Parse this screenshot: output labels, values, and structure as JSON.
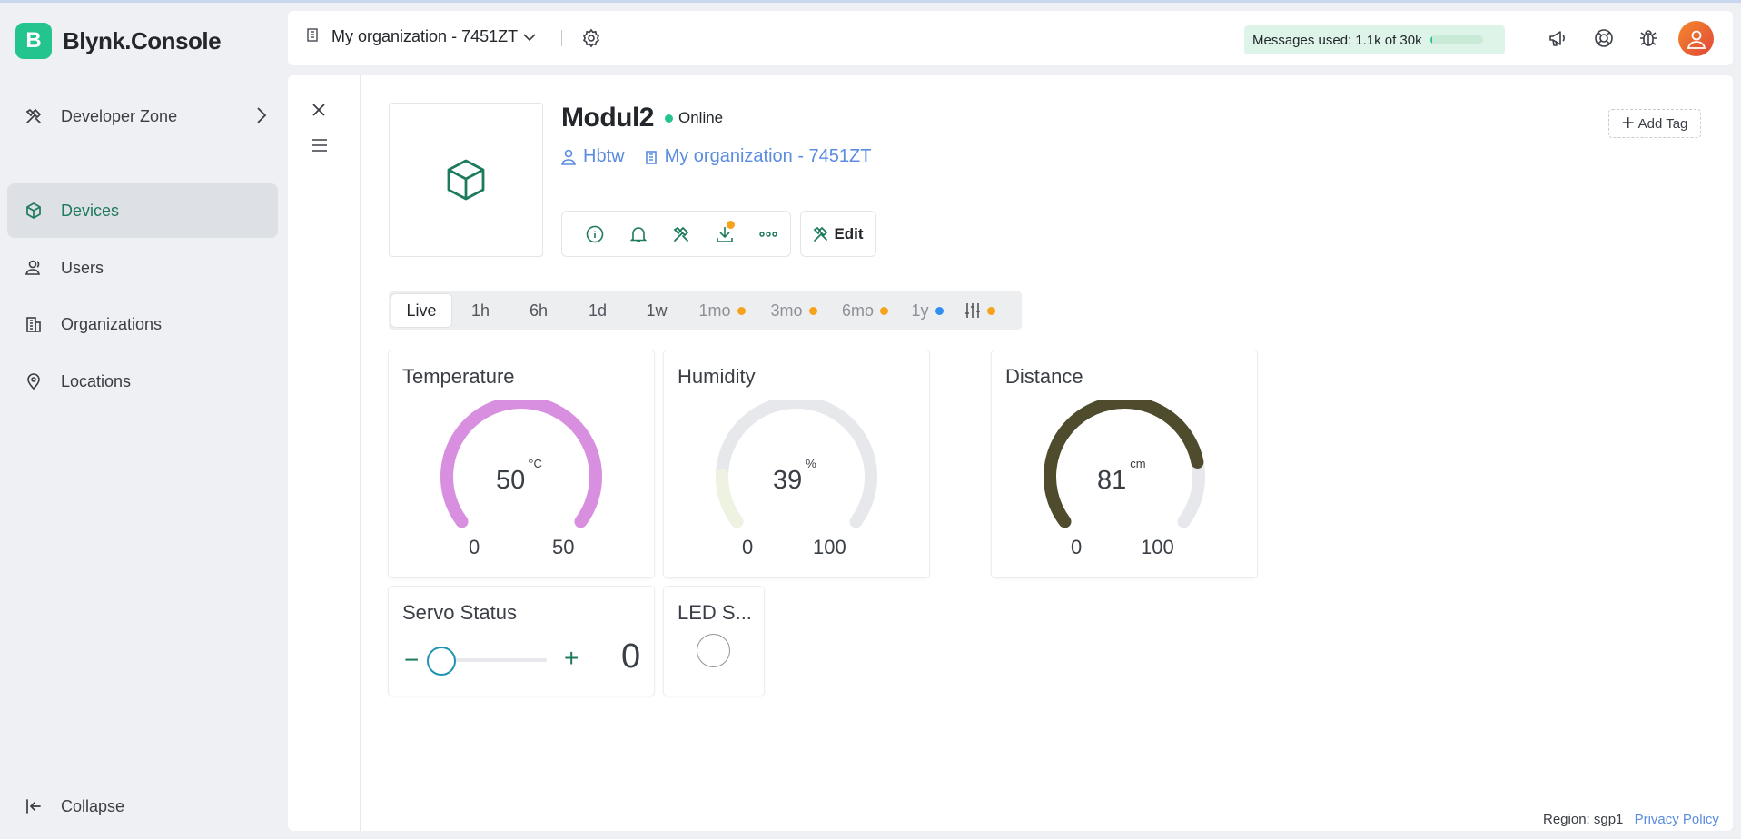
{
  "app": {
    "logo_letter": "B",
    "name": "Blynk.Console"
  },
  "sidebar": {
    "developer_zone": "Developer Zone",
    "items": [
      {
        "label": "Devices",
        "icon": "cube-icon",
        "active": true
      },
      {
        "label": "Users",
        "icon": "users-icon",
        "active": false
      },
      {
        "label": "Organizations",
        "icon": "buildings-icon",
        "active": false
      },
      {
        "label": "Locations",
        "icon": "location-pin-icon",
        "active": false
      }
    ],
    "collapse": "Collapse"
  },
  "header": {
    "organization": "My organization - 7451ZT",
    "messages_label": "Messages used:",
    "messages_value": "1.1k of 30k",
    "messages_fraction": 0.037,
    "icons": [
      "megaphone-icon",
      "lifebuoy-icon",
      "bug-icon",
      "avatar"
    ]
  },
  "device": {
    "name": "Modul2",
    "status": "Online",
    "owner": "Hbtw",
    "organization": "My organization - 7451ZT",
    "actions": [
      "info-icon",
      "bell-icon",
      "tools-icon",
      "download-icon",
      "more-icon"
    ],
    "edit_label": "Edit",
    "add_tag_label": "Add Tag"
  },
  "time_ranges": [
    {
      "label": "Live",
      "active": true,
      "dot": null
    },
    {
      "label": "1h",
      "active": false,
      "dot": null
    },
    {
      "label": "6h",
      "active": false,
      "dot": null
    },
    {
      "label": "1d",
      "active": false,
      "dot": null
    },
    {
      "label": "1w",
      "active": false,
      "dot": null
    },
    {
      "label": "1mo",
      "active": false,
      "dot": "#f7a21b"
    },
    {
      "label": "3mo",
      "active": false,
      "dot": "#f7a21b"
    },
    {
      "label": "6mo",
      "active": false,
      "dot": "#f7a21b"
    },
    {
      "label": "1y",
      "active": false,
      "dot": "#2f8ef0"
    },
    {
      "label": "",
      "icon": "sliders-icon",
      "active": false,
      "dot": "#f7a21b"
    }
  ],
  "widgets": {
    "temperature": {
      "title": "Temperature",
      "value": "50",
      "unit": "°C",
      "min": "0",
      "max": "50",
      "fraction": 1.0,
      "color": "#d98fe0"
    },
    "humidity": {
      "title": "Humidity",
      "value": "39",
      "unit": "%",
      "min": "0",
      "max": "100",
      "fraction": 0.15,
      "color": "#eef2e0"
    },
    "distance": {
      "title": "Distance",
      "value": "81",
      "unit": "cm",
      "min": "0",
      "max": "100",
      "fraction": 0.81,
      "color": "#4f4b2d"
    },
    "servo": {
      "title": "Servo Status",
      "minus": "−",
      "plus": "+",
      "value": "0",
      "fraction": 0.0
    },
    "led": {
      "title": "LED S..."
    }
  },
  "footer": {
    "region": "Region: sgp1",
    "privacy": "Privacy Policy"
  }
}
